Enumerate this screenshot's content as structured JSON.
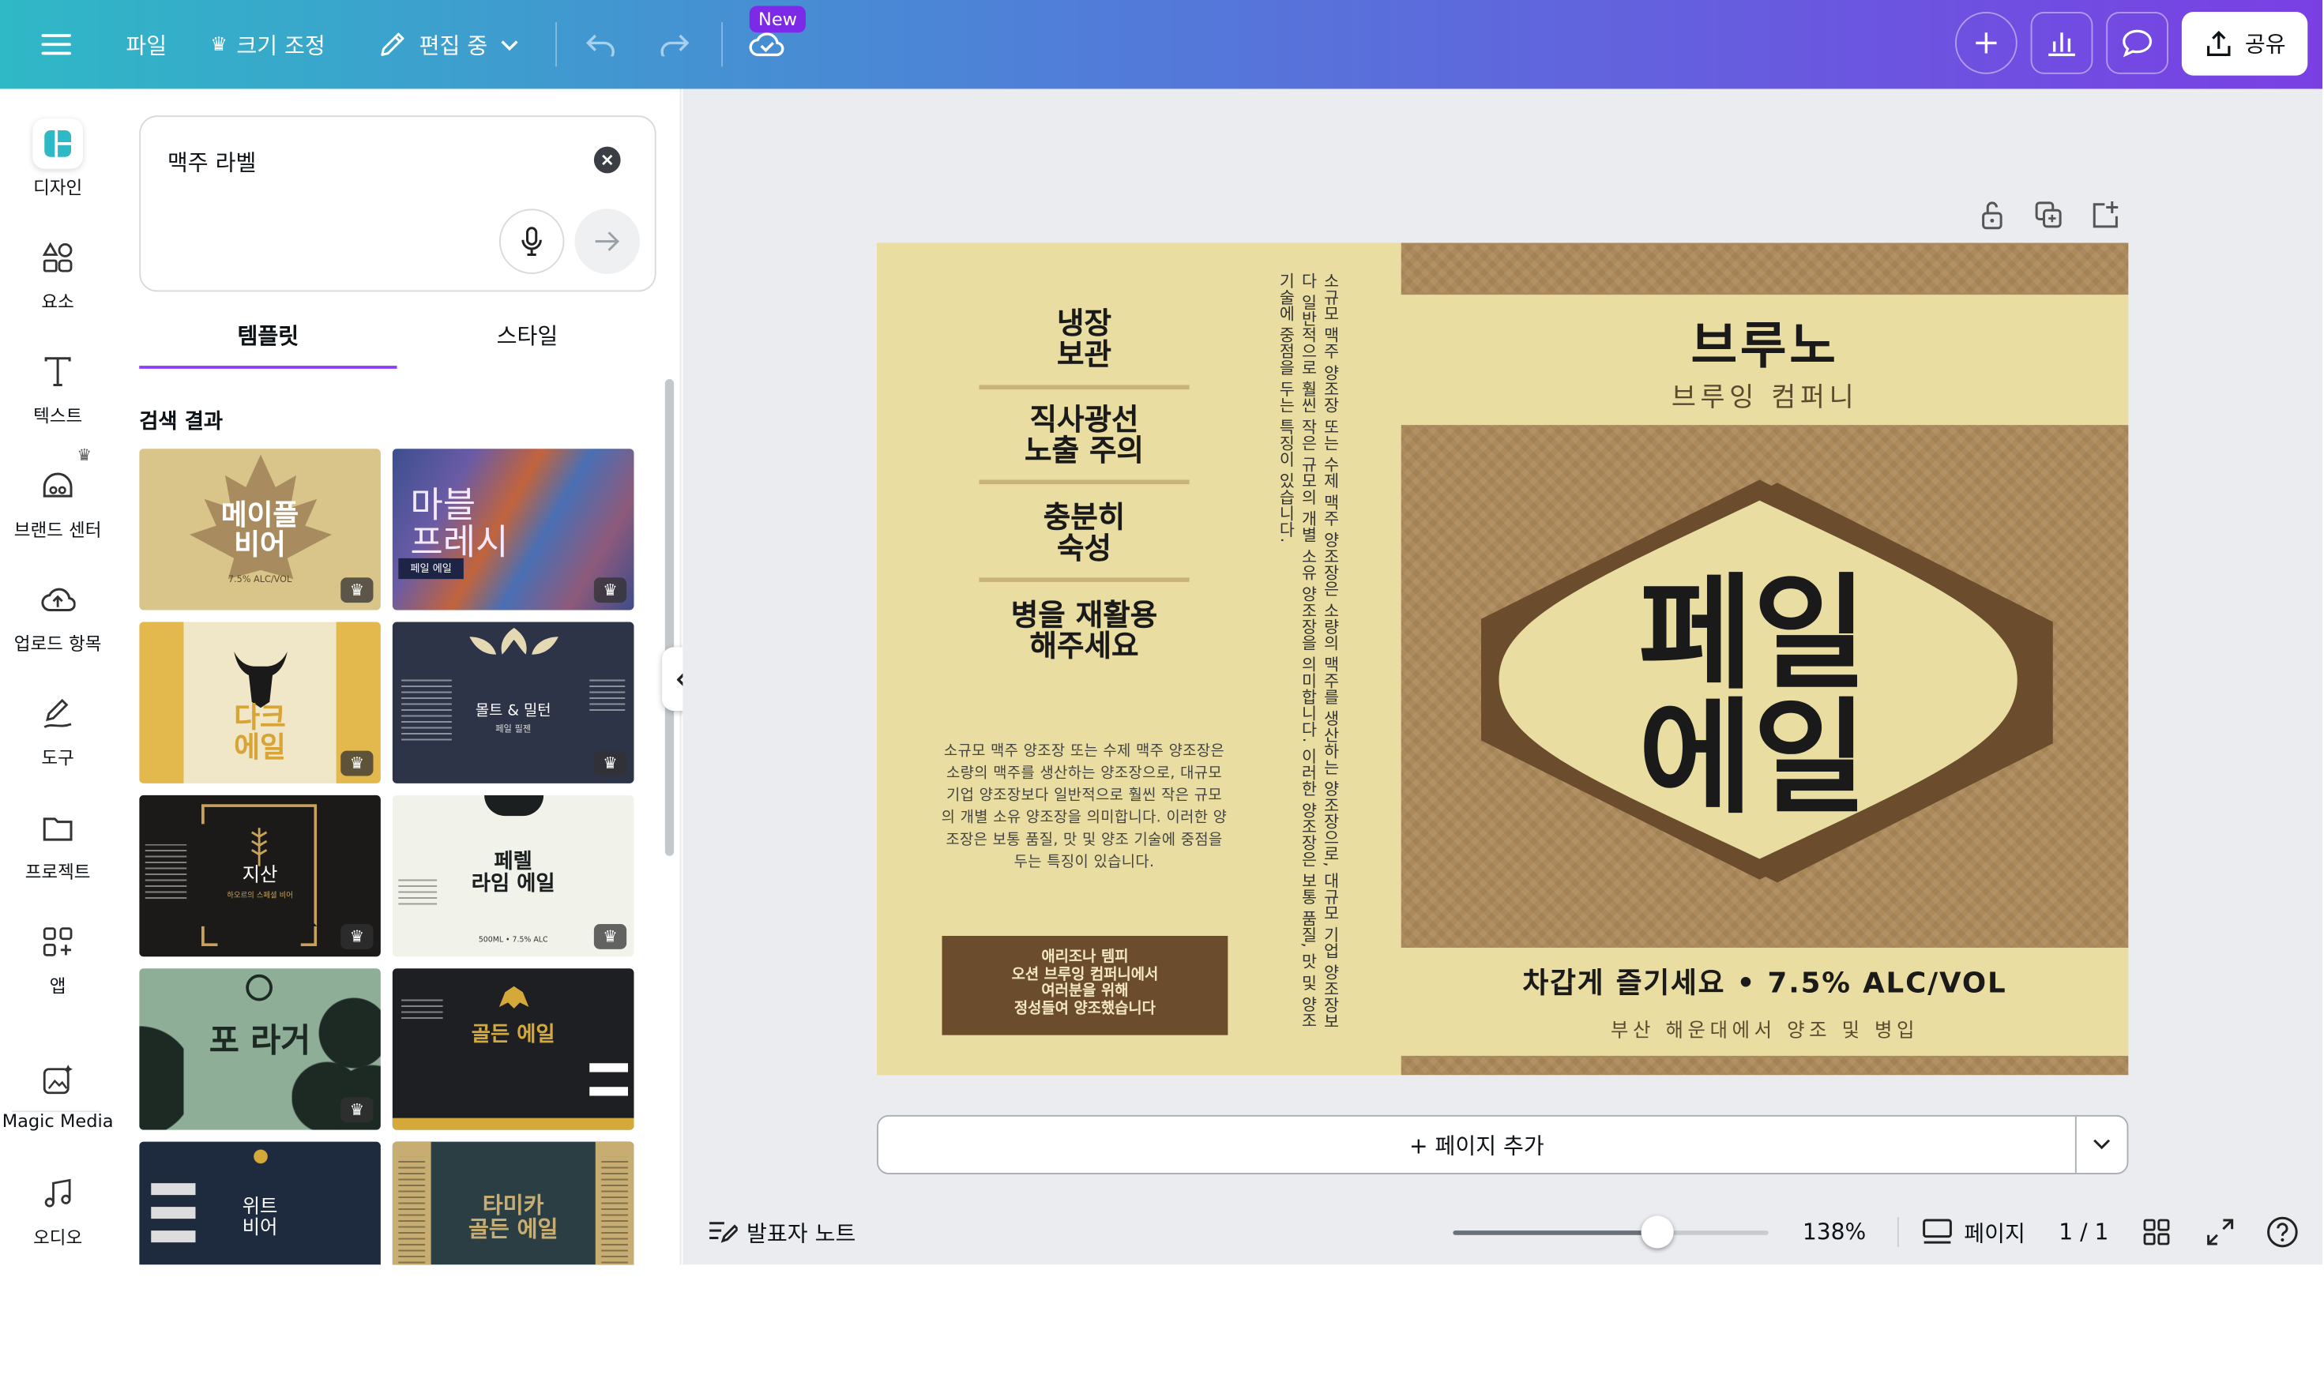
{
  "header": {
    "file": "파일",
    "resize": "크기 조정",
    "editing": "편집 중",
    "new_badge": "New",
    "share": "공유"
  },
  "rail": [
    {
      "label": "디자인",
      "icon": "design-icon"
    },
    {
      "label": "요소",
      "icon": "elements-icon"
    },
    {
      "label": "텍스트",
      "icon": "text-icon"
    },
    {
      "label": "브랜드 센터",
      "icon": "brand-icon"
    },
    {
      "label": "업로드 항목",
      "icon": "upload-icon"
    },
    {
      "label": "도구",
      "icon": "draw-icon"
    },
    {
      "label": "프로젝트",
      "icon": "folder-icon"
    },
    {
      "label": "앱",
      "icon": "apps-icon"
    },
    {
      "label": "Magic Media",
      "icon": "magic-media-icon"
    },
    {
      "label": "오디오",
      "icon": "audio-icon"
    }
  ],
  "panel": {
    "search_value": "맥주 라벨",
    "tabs": [
      "템플릿",
      "스타일"
    ],
    "results_heading": "검색 결과",
    "templates": [
      {
        "title": "메이플\n비어",
        "sub": "7.5% ALC/VOL"
      },
      {
        "title": "마블\n프레시",
        "sub": "페일 에일"
      },
      {
        "title": "다크\n에일",
        "sub": "다크 에일"
      },
      {
        "title": "몰트 & 밀턴",
        "sub": "페일 필젠"
      },
      {
        "title": "지산",
        "sub": "하오르의 스페셜 비어"
      },
      {
        "title": "페렐\n라임 에일",
        "sub": "500ML • 7.5% ALC"
      },
      {
        "title": "포 라거",
        "sub": ""
      },
      {
        "title": "골든 에일",
        "sub": ""
      },
      {
        "title": "위트\n비어",
        "sub": ""
      },
      {
        "title": "타미카\n골든 에일",
        "sub": ""
      }
    ]
  },
  "label": {
    "left_items": [
      "냉장\n보관",
      "직사광선\n노출 주의",
      "충분히\n숙성",
      "병을 재활용\n해주세요"
    ],
    "paragraph": "소규모 맥주 양조장 또는 수제 맥주 양조장은 소량의 맥주를 생산하는 양조장으로, 대규모 기업 양조장보다 일반적으로 훨씬 작은 규모의 개별 소유 양조장을 의미합니다. 이러한 양조장은 보통 품질, 맛 및 양조 기술에 중점을 두는 특징이 있습니다.",
    "box_text": "애리조나 템피\n오션 브루잉 컴퍼니에서\n여러분을 위해\n정성들여 양조했습니다",
    "vertical_text": "소규모 맥주 양조장 또는 수제 맥주 양조장은 소량의 맥주를 생산하는 양조장으로, 대규모 기업 양조장보다 일반적으로 훨씬 작은 규모의 개별 소유 양조장을 의미합니다. 이러한 양조장은 보통 품질, 맛 및 양조 기술에 중점을 두는 특징이 있습니다.",
    "brand": "브루노",
    "brand_sub": "브루잉 컴퍼니",
    "product": "페일\n에일",
    "tagline": "차갑게 즐기세요 • 7.5% ALC/VOL",
    "origin": "부산 해운대에서 양조 및 병입"
  },
  "canvas": {
    "add_page": "+ 페이지 추가"
  },
  "footer": {
    "notes": "발표자 노트",
    "zoom_level": 0.65,
    "zoom": "138%",
    "pages": "페이지",
    "page_count": "1 / 1"
  },
  "colors": {
    "accent": "#8b3dff",
    "label_cream": "#e9dda1",
    "label_brown": "#6b4c2c",
    "label_tan": "#ad8a5b"
  }
}
